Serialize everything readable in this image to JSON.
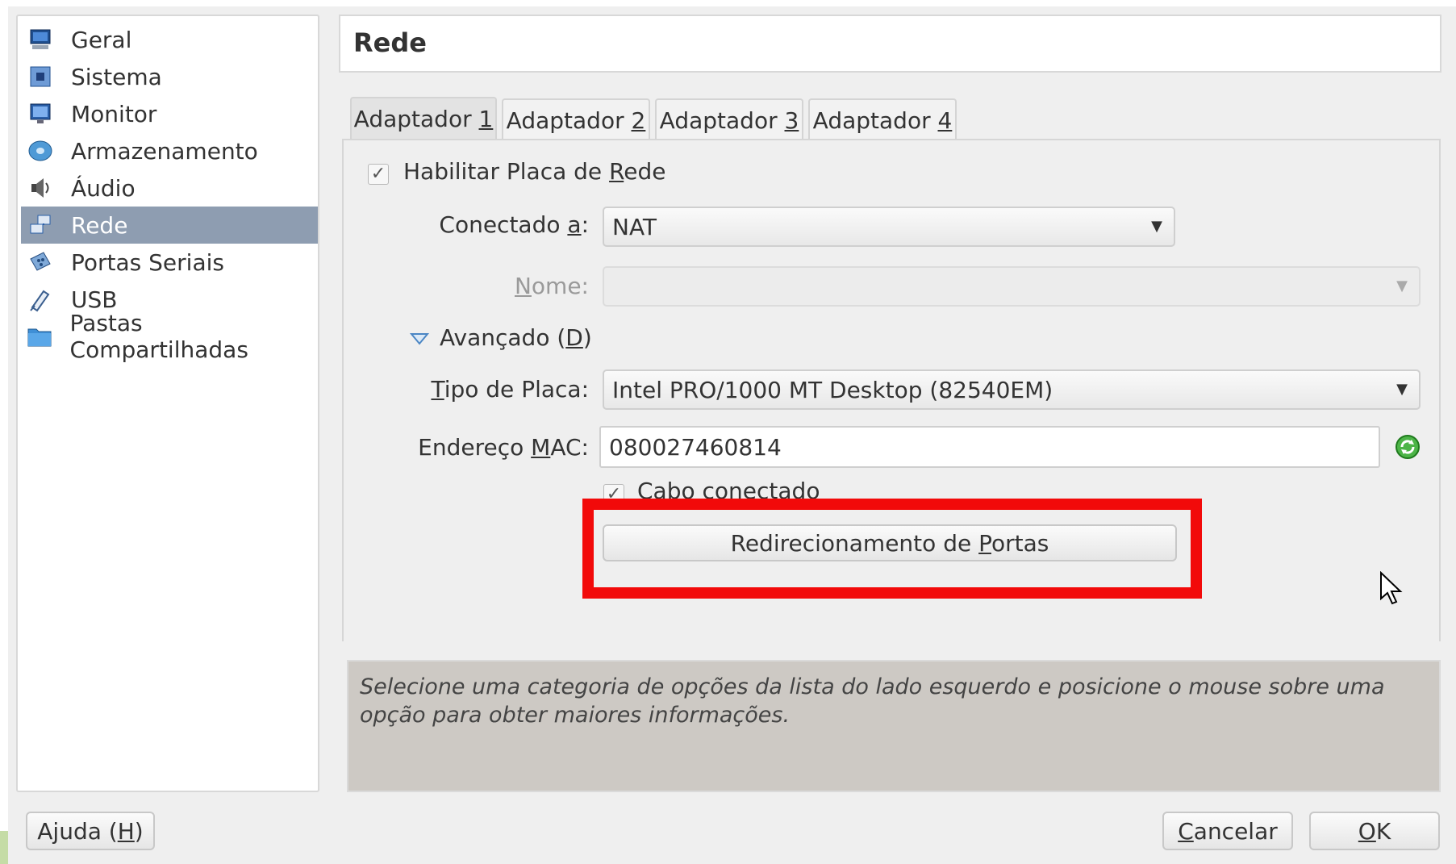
{
  "sidebar": {
    "items": [
      {
        "label": "Geral",
        "icon": "monitor-icon"
      },
      {
        "label": "Sistema",
        "icon": "chip-icon"
      },
      {
        "label": "Monitor",
        "icon": "display-icon"
      },
      {
        "label": "Armazenamento",
        "icon": "disk-icon"
      },
      {
        "label": "Áudio",
        "icon": "speaker-icon"
      },
      {
        "label": "Rede",
        "icon": "network-icon",
        "selected": true
      },
      {
        "label": "Portas Seriais",
        "icon": "serial-port-icon"
      },
      {
        "label": "USB",
        "icon": "usb-icon"
      },
      {
        "label": "Pastas Compartilhadas",
        "icon": "folder-icon"
      }
    ]
  },
  "header": {
    "title": "Rede"
  },
  "tabs": [
    {
      "prefix": "Adaptador ",
      "mnemonic": "1",
      "active": true
    },
    {
      "prefix": "Adaptador ",
      "mnemonic": "2"
    },
    {
      "prefix": "Adaptador ",
      "mnemonic": "3"
    },
    {
      "prefix": "Adaptador ",
      "mnemonic": "4"
    }
  ],
  "form": {
    "enable_adapter": {
      "label_pre": "Habilitar Placa de ",
      "label_mn": "R",
      "label_post": "ede",
      "checked": true
    },
    "attached_to": {
      "label_pre": "Conectado ",
      "label_mn": "a",
      "label_post": ":",
      "value": "NAT"
    },
    "name": {
      "label_mn": "N",
      "label_post": "ome:",
      "value": ""
    },
    "advanced": {
      "label_pre": "Avançado (",
      "label_mn": "D",
      "label_post": ")"
    },
    "adapter_type": {
      "label_mn": "T",
      "label_post": "ipo de Placa:",
      "value": "Intel PRO/1000 MT Desktop (82540EM)"
    },
    "mac": {
      "label_pre": "Endereço ",
      "label_mn": "M",
      "label_post": "AC:",
      "value": "080027460814"
    },
    "cable": {
      "label": "Cabo conectado",
      "checked": true
    },
    "port_forwarding": {
      "label_pre": "Redirecionamento de ",
      "label_mn": "P",
      "label_post": "ortas"
    }
  },
  "info_text": "Selecione uma categoria de opções da lista do lado esquerdo e posicione o mouse sobre uma opção para obter maiores informações.",
  "footer": {
    "help": {
      "label_pre": "Ajuda (",
      "label_mn": "H",
      "label_post": ")"
    },
    "cancel": {
      "label_mn": "C",
      "label_post": "ancelar"
    },
    "ok": {
      "label_mn": "O",
      "label_post": "K"
    }
  },
  "colors": {
    "highlight": "#f20a0a",
    "selected_row": "#8e9db1",
    "refresh_icon": "#3fa53a"
  }
}
